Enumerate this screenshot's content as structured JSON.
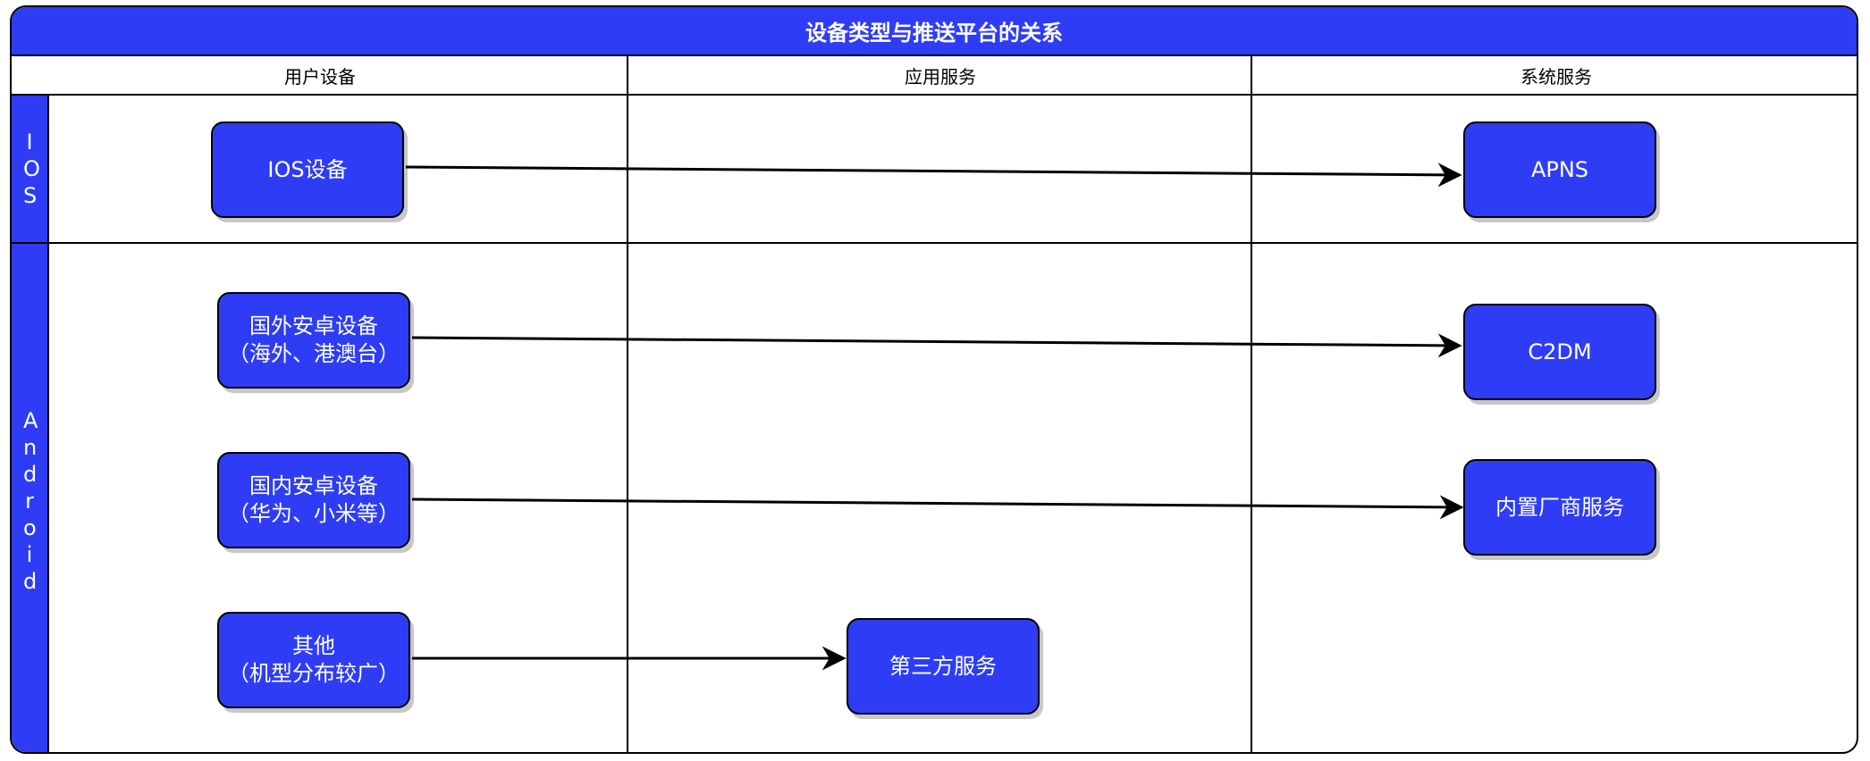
{
  "title": "设备类型与推送平台的关系",
  "columns": [
    {
      "label": "用户设备"
    },
    {
      "label": "应用服务"
    },
    {
      "label": "系统服务"
    }
  ],
  "lanes": [
    {
      "label": "IOS"
    },
    {
      "label": "Android"
    }
  ],
  "nodes": {
    "ios_device": {
      "lines": [
        "IOS设备"
      ]
    },
    "apns": {
      "lines": [
        "APNS"
      ]
    },
    "foreign_android": {
      "lines": [
        "国外安卓设备",
        "（海外、港澳台）"
      ]
    },
    "c2dm": {
      "lines": [
        "C2DM"
      ]
    },
    "domestic_android": {
      "lines": [
        "国内安卓设备",
        "（华为、小米等）"
      ]
    },
    "vendor_service": {
      "lines": [
        "内置厂商服务"
      ]
    },
    "other": {
      "lines": [
        "其他",
        "（机型分布较广）"
      ]
    },
    "third_party": {
      "lines": [
        "第三方服务"
      ]
    }
  },
  "edges": [
    {
      "from": "ios_device",
      "to": "apns"
    },
    {
      "from": "foreign_android",
      "to": "c2dm"
    },
    {
      "from": "domestic_android",
      "to": "vendor_service"
    },
    {
      "from": "other",
      "to": "third_party"
    }
  ],
  "colors": {
    "fill": "#2e3df5",
    "stroke": "#000000",
    "text": "#ffffff"
  }
}
